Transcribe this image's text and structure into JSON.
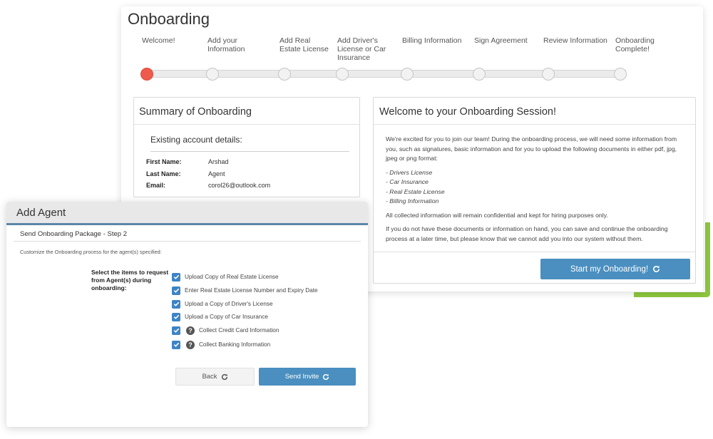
{
  "onboarding": {
    "title": "Onboarding",
    "steps": [
      {
        "label": "Welcome!"
      },
      {
        "label": "Add your Information"
      },
      {
        "label": "Add Real Estate License"
      },
      {
        "label": "Add Driver's License or Car Insurance"
      },
      {
        "label": "Billing Information"
      },
      {
        "label": "Sign Agreement"
      },
      {
        "label": "Review Information"
      },
      {
        "label": "Onboarding Complete!"
      }
    ],
    "current_step": 1,
    "summary": {
      "title": "Summary of Onboarding",
      "subtitle": "Existing account details:",
      "fields": [
        {
          "label": "First Name:",
          "value": "Arshad"
        },
        {
          "label": "Last Name:",
          "value": "Agent"
        },
        {
          "label": "Email:",
          "value": "corol26@outlook.com"
        }
      ]
    },
    "welcome": {
      "title": "Welcome to your Onboarding Session!",
      "intro": "We're excited for you to join our team! During the onboarding process, we will need some information from you, such as signatures, basic information and for you to upload the following documents in either pdf, jpg, jpeg or png format:",
      "documents": [
        "- Drivers License",
        "- Car Insurance",
        "- Real Estate License",
        "- Billing Information"
      ],
      "confidential": "All collected information will remain confidential and kept for hiring purposes only.",
      "note": "If you do not have these documents or information on hand, you can save and continue the onboarding process at a later time, but please know that we cannot add you into our system without them.",
      "start_label": "Start my Onboarding!"
    }
  },
  "add_agent": {
    "title": "Add Agent",
    "step": "Send Onboarding Package - Step 2",
    "description": "Customize the Onboarding process for the agent(s) specified:",
    "select_label": "Select the items to request from Agent(s) during onboarding:",
    "options": [
      {
        "label": "Upload Copy of Real Estate License",
        "checked": true,
        "help": false
      },
      {
        "label": "Enter Real Estate License Number and Expiry Date",
        "checked": true,
        "help": false
      },
      {
        "label": "Upload a Copy of Driver's License",
        "checked": true,
        "help": false
      },
      {
        "label": "Upload a Copy of Car Insurance",
        "checked": true,
        "help": false
      },
      {
        "label": "Collect Credit Card Information",
        "checked": true,
        "help": true
      },
      {
        "label": "Collect Banking Information",
        "checked": true,
        "help": true
      }
    ],
    "back_label": "Back",
    "send_label": "Send Invite"
  },
  "colors": {
    "accent_blue": "#4a8fc0",
    "active_step": "#ee5a4b",
    "green_accent": "#8cc63f"
  },
  "icons": {
    "refresh": "refresh-icon",
    "check": "checkmark-icon",
    "help": "help-icon"
  }
}
